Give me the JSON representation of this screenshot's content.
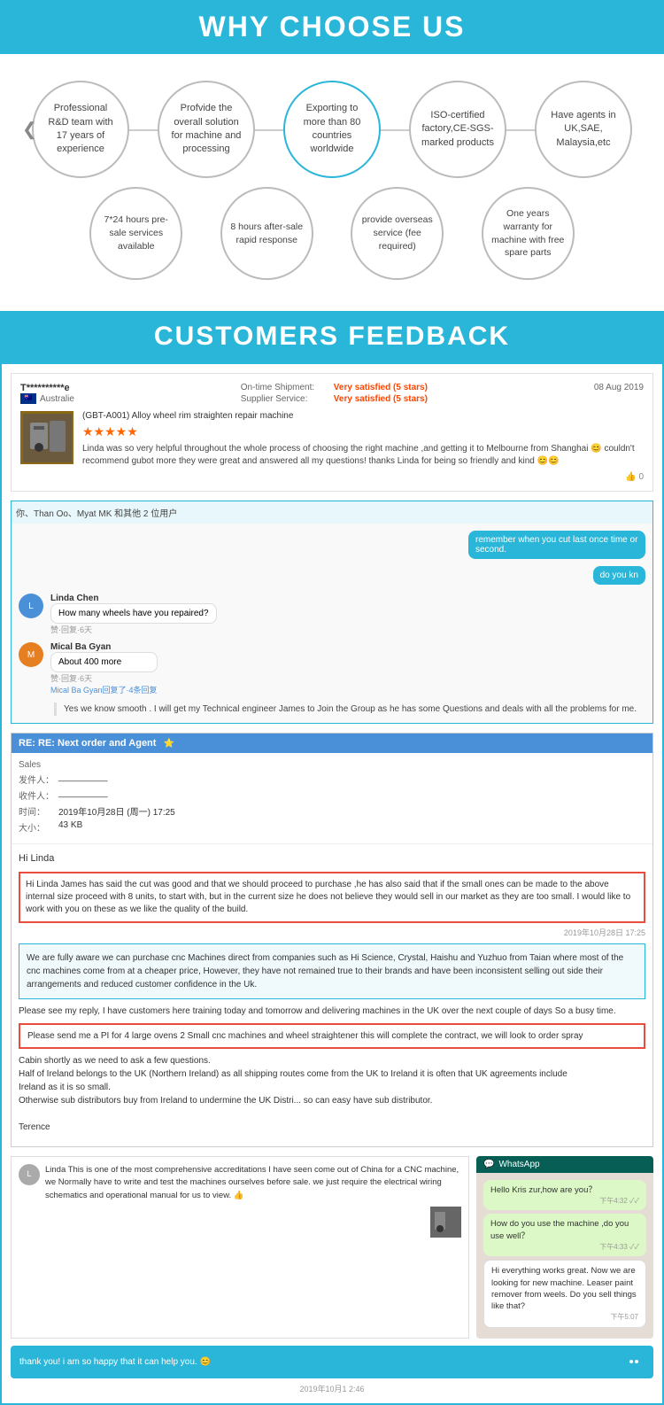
{
  "why_section": {
    "title": "WHY CHOOSE US",
    "top_features": [
      {
        "text": "Professional R&D team with 17 years of experience"
      },
      {
        "text": "Profvide the overall solution for machine and processing"
      },
      {
        "text": "Exporting to more than 80 countries worldwide"
      },
      {
        "text": "ISO-certified factory,CE-SGS-marked products"
      },
      {
        "text": "Have agents in UK,SAE, Malaysia,etc"
      }
    ],
    "bottom_features": [
      {
        "text": "7*24 hours pre-sale services available"
      },
      {
        "text": "8 hours after-sale rapid response"
      },
      {
        "text": "provide overseas service (fee required)"
      },
      {
        "text": "One years warranty for machine with free spare parts"
      }
    ]
  },
  "feedback_section": {
    "title": "CUSTOMERS FEEDBACK",
    "review": {
      "reviewer": "T**********e",
      "country": "Australie",
      "on_time_shipment": "Very satisfied  (5 stars)",
      "supplier_service": "Very satisfied  (5 stars)",
      "date": "08 Aug 2019",
      "product_name": "(GBT-A001) Alloy wheel rim straighten repair machine",
      "stars": "★★★★★",
      "review_text": "Linda was so very helpful throughout the whole process of choosing the right machine ,and getting it to Melbourne from Shanghai 😊 couldn't recommend gubot more they were great and answered all my questions! thanks Linda for being so friendly and kind 😊😊",
      "likes": "0"
    },
    "chat1": {
      "header": "你、Than Oo、Myat MK 和其他 2 位用户",
      "right_msgs": [
        "remember when you cut last once time or second.",
        "do you kn"
      ],
      "msg1_name": "Linda Chen",
      "msg1_text": "How many wheels have you repaired?",
      "msg1_sub": "赞·回复·6天",
      "msg2_name": "Mical Ba Gyan",
      "msg2_text": "About 400 more",
      "msg2_sub": "赞·回复·6天",
      "msg2_reply": "Mical Ba Gyan回复了·4条回复",
      "reply_text": "Yes we know smooth . I will get my Technical engineer James to Join the Group as he has some Questions and deals with all the problems for me."
    },
    "email": {
      "subject": "RE: RE: Next order and Agent",
      "from_label": "Sales",
      "fa_label": "发件人：",
      "to_label": "收件人：",
      "time_label": "时间：",
      "time_value": "2019年10月28日 (周一) 17:25",
      "size_label": "大小：",
      "size_value": "43 KB",
      "highlighted1": "Hi Linda James has said the cut was good and that we should proceed to purchase ,he has also said that if the small ones can be made to the above internal size proceed with 8 units, to start with, but in the current size he does not believe they would sell in our market as they are too small. I would like to work with you on these as we like the quality of the build.",
      "info_text": "We are fully aware we can purchase cnc Machines direct from companies such as Hi Science, Crystal, Haishu and Yuzhuo from Taian where most of the cnc machines come from at a cheaper price,\nHowever, they have not remained true to their brands and have been inconsistent selling out side their arrangements and reduced customer confidence in the Uk.",
      "body_text": "Please see my reply, I have customers here training today and tomorrow and delivering machines in the UK over the next couple of days\nSo a busy time.",
      "order_text": "Please send me a PI for 4 large ovens 2 Small cnc machines and wheel straightener this will complete the contract, we will look to order spray",
      "body2": "Cabin shortly as we need to ask a few questions.\nHalf of Ireland belongs to the UK (Northern Ireland) as all shipping routes come from the UK to Ireland it is often that UK agreements include\nIreland as it is so small.\nOtherwise sub distributors buy from Ireland to undermine the UK Distri... so can easy have sub distributor.\n\nTerence"
    },
    "bottom_review_text": "Linda This is one of the most comprehensive accreditations I have seen come out of China for a CNC machine, we Normally have to write and test the machines ourselves before sale. we just require the electrical wiring schematics and operational manual for us to view. 👍",
    "whatsapp": {
      "msg1": "Hello Kris zur,how are you？",
      "time1": "下午4:32 ✓✓",
      "msg2": "How do you use the machine ,do you use well？",
      "time2": "下午4:33 ✓✓",
      "reply": "Hi everything works great. Now we are looking for new machine. Leaser paint remover from weels. Do you sell things like that?",
      "time3": "下午5:07",
      "final_msg": "thank you! i am so happy that it can help you. 😊",
      "timestamp": "2019年10月1 2:46"
    }
  }
}
